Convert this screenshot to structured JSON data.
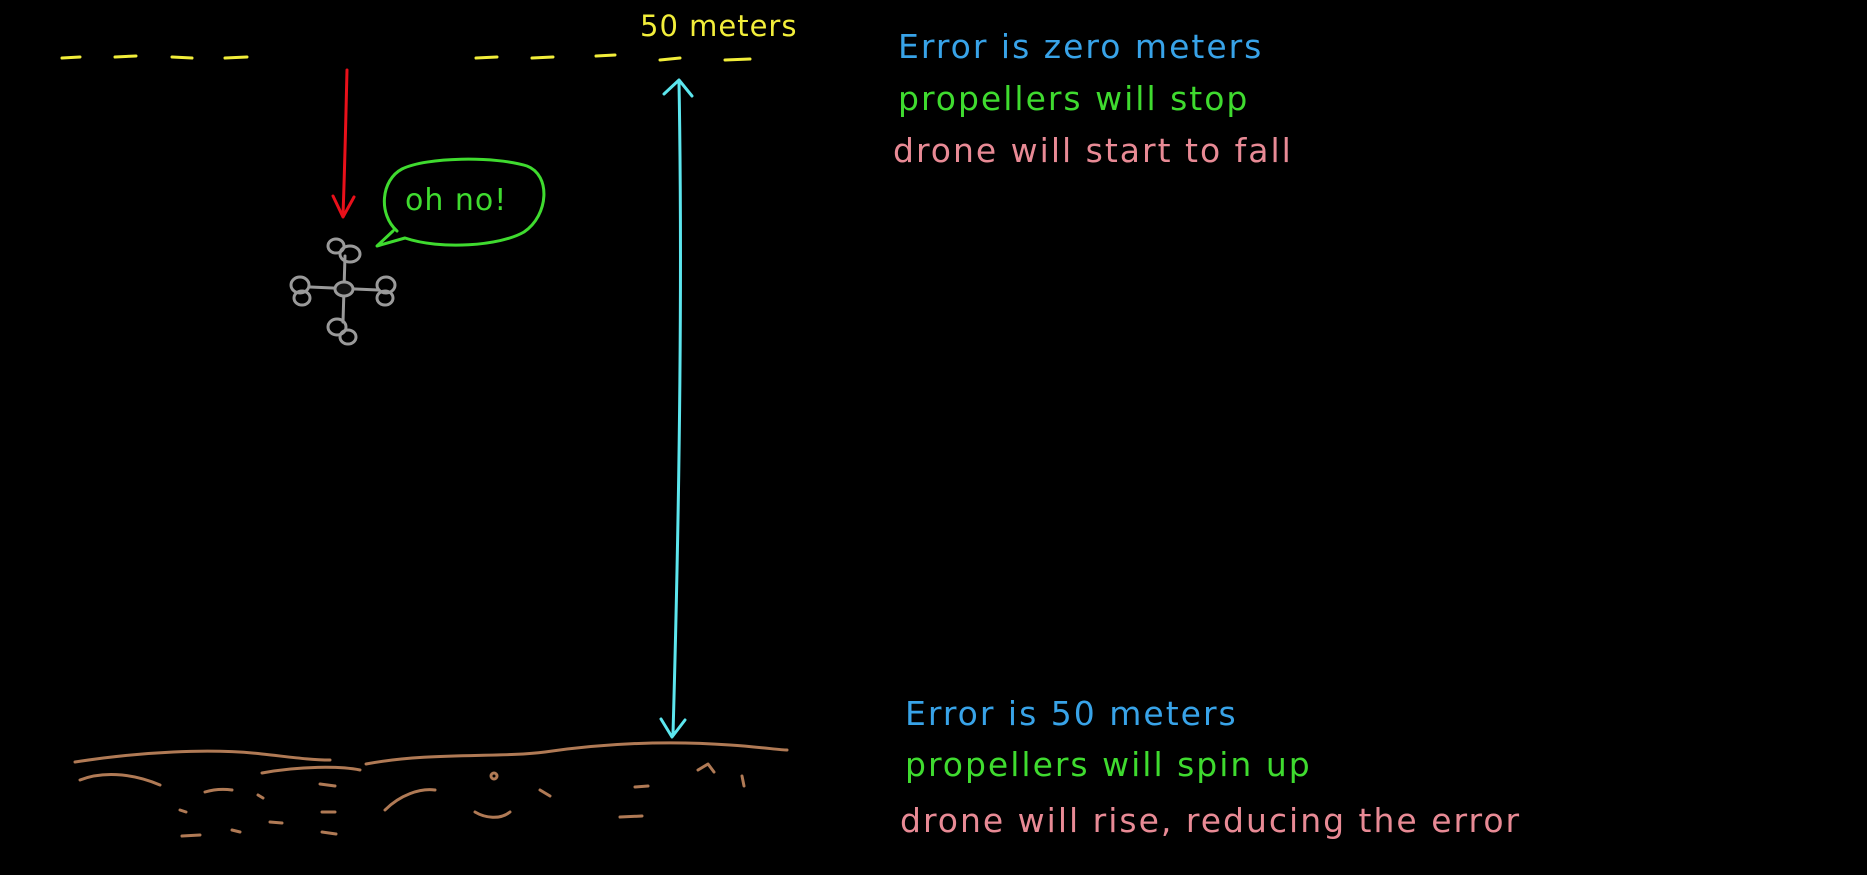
{
  "target_label": "50 meters",
  "speech_bubble": "oh no!",
  "top_notes": {
    "error": "Error is zero meters",
    "propellers": "propellers will stop",
    "drone": "drone will start to fall"
  },
  "bottom_notes": {
    "error": "Error is 50 meters",
    "propellers": "propellers will spin up",
    "drone": "drone will rise, reducing the error"
  },
  "colors": {
    "background": "#000000",
    "target_line": "#f2ee3a",
    "fall_arrow": "#e8101a",
    "distance_arrow": "#5ce6ee",
    "bubble": "#3fdb2f",
    "drone": "#9a9a9a",
    "ground": "#b07a55",
    "blue_text": "#38a3e8",
    "green_text": "#3fdb2f",
    "pink_text": "#e88a95"
  }
}
